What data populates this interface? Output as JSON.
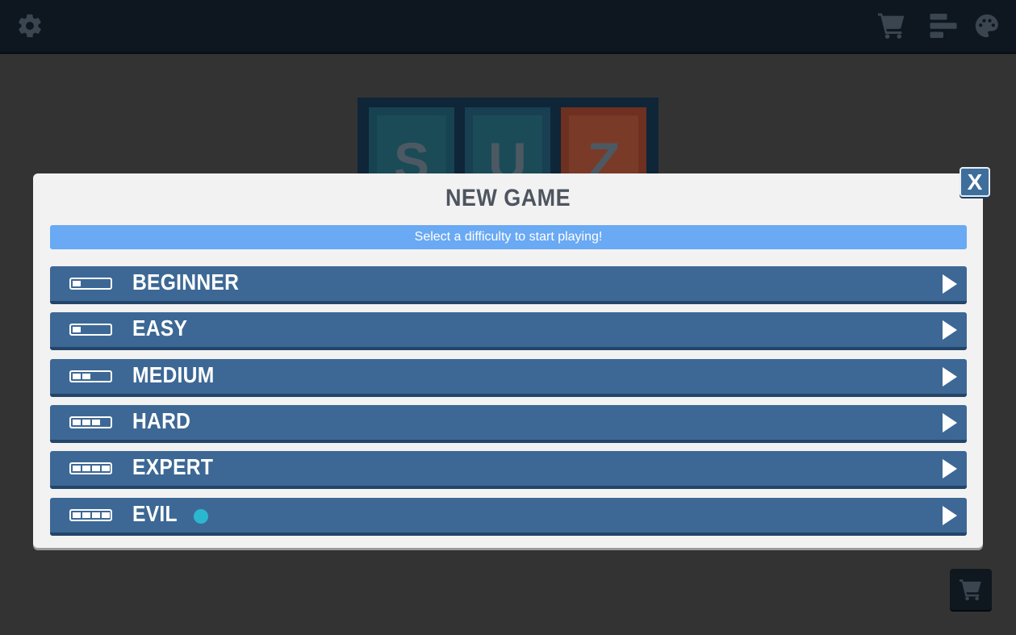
{
  "topbar": {
    "left_icons": [
      "gear-icon"
    ],
    "right_icons": [
      "cart-icon",
      "leaderboard-icon",
      "palette-icon"
    ]
  },
  "logo": {
    "tiles": [
      "S",
      "U",
      "Z"
    ]
  },
  "modal": {
    "title": "NEW GAME",
    "close_label": "X",
    "subtitle": "Select a difficulty to start playing!",
    "difficulties": [
      {
        "label": "BEGINNER",
        "level": 1
      },
      {
        "label": "EASY",
        "level": 1
      },
      {
        "label": "MEDIUM",
        "level": 2
      },
      {
        "label": "HARD",
        "level": 3
      },
      {
        "label": "EXPERT",
        "level": 4
      },
      {
        "label": "EVIL",
        "level": 4
      }
    ]
  },
  "colors": {
    "topbar_bg": "#0e1620",
    "modal_bg": "#f2f2f2",
    "banner_bg": "#6aa9f3",
    "row_bg": "#3d6895",
    "indicator_dot": "#2cb7d0"
  }
}
